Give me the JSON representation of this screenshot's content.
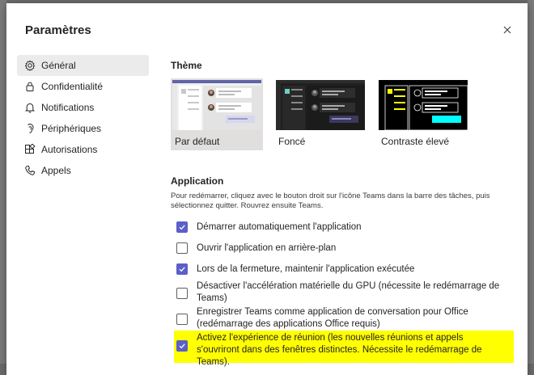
{
  "dialog": {
    "title": "Paramètres"
  },
  "sidebar": {
    "items": [
      {
        "label": "Général",
        "icon": "gear-icon",
        "active": true
      },
      {
        "label": "Confidentialité",
        "icon": "lock-icon"
      },
      {
        "label": "Notifications",
        "icon": "bell-icon"
      },
      {
        "label": "Périphériques",
        "icon": "devices-icon"
      },
      {
        "label": "Autorisations",
        "icon": "apps-icon"
      },
      {
        "label": "Appels",
        "icon": "phone-icon"
      }
    ]
  },
  "theme": {
    "title": "Thème",
    "options": [
      {
        "label": "Par défaut",
        "selected": true
      },
      {
        "label": "Foncé",
        "selected": false
      },
      {
        "label": "Contraste élevé",
        "selected": false
      }
    ]
  },
  "application": {
    "title": "Application",
    "hint": "Pour redémarrer, cliquez avec le bouton droit sur l'icône Teams dans la barre des tâches, puis sélectionnez quitter. Rouvrez ensuite Teams.",
    "options": [
      {
        "label": "Démarrer automatiquement l'application",
        "checked": true
      },
      {
        "label": "Ouvrir l'application en arrière-plan",
        "checked": false
      },
      {
        "label": "Lors de la fermeture, maintenir l'application exécutée",
        "checked": true
      },
      {
        "label": "Désactiver l'accélération matérielle du GPU (nécessite le redémarrage de Teams)",
        "checked": false
      },
      {
        "label": "Enregistrer Teams comme application de conversation pour Office (redémarrage des applications Office requis)",
        "checked": false
      },
      {
        "label": "Activez l'expérience de réunion (les nouvelles réunions et appels s'ouvriront dans des fenêtres distinctes. Nécessite le redémarrage de Teams).",
        "checked": true
      }
    ]
  },
  "colors": {
    "accent": "#5b5fc7",
    "highlight": "#ffff00"
  }
}
